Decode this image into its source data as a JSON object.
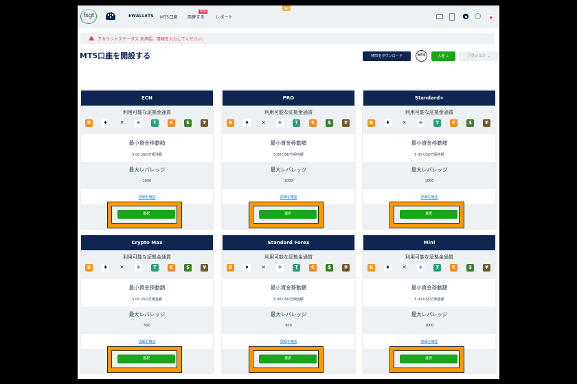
{
  "nav": {
    "logo": "fxgt",
    "items": [
      "EWALLETS",
      "MT5口座",
      "両替する",
      "レポート"
    ],
    "new_badge": "NEW"
  },
  "alert": {
    "text": "アカウントステータス 未承認。情報を入力してください。"
  },
  "header": {
    "title": "MT5口座を開設する",
    "download_label": "MT5をダウンロード",
    "mt5_logo": "MT5",
    "deposit_label": "入金 ⊥",
    "action_label": "アクション ⌄"
  },
  "colors": {
    "navy": "#0e2650",
    "green": "#1aa51a",
    "highlight": "#ff9900",
    "alert": "#e2403f",
    "link": "#1a7ad4"
  },
  "coins": [
    {
      "name": "bitcoin",
      "glyph": "B",
      "color": "#f7931a"
    },
    {
      "name": "ethereum",
      "glyph": "♦",
      "color": "#ffffff",
      "fg": "#222"
    },
    {
      "name": "ripple",
      "glyph": "✕",
      "color": "#eef1f3",
      "fg": "#222"
    },
    {
      "name": "cardano",
      "glyph": "❋",
      "color": "#ffffff",
      "fg": "#3c7de0"
    },
    {
      "name": "tether",
      "glyph": "T",
      "color": "#26a17b"
    },
    {
      "name": "euro",
      "glyph": "€",
      "color": "#f58a1f"
    },
    {
      "name": "dollar",
      "glyph": "$",
      "color": "#3e7d2a"
    },
    {
      "name": "yen",
      "glyph": "¥",
      "color": "#6e5a2a"
    }
  ],
  "cards": [
    {
      "name": "ECN",
      "currencies_label": "利用可能な証拠金通貨",
      "min_transfer_label": "最小資金移動額",
      "min_transfer_value": "5.00 USD方相当額",
      "max_leverage_label": "最大レバレッジ",
      "max_leverage_value": "1000",
      "details_link": "詳細を確認",
      "select_label": "選択"
    },
    {
      "name": "PRO",
      "currencies_label": "利用可能な証拠金通貨",
      "min_transfer_label": "最小資金移動額",
      "min_transfer_value": "5.00 USD方相当額",
      "max_leverage_label": "最大レバレッジ",
      "max_leverage_value": "1000",
      "details_link": "詳細を確認",
      "select_label": "選択"
    },
    {
      "name": "Standard+",
      "currencies_label": "利用可能な証拠金通貨",
      "min_transfer_label": "最小資金移動額",
      "min_transfer_value": "5.00 USD方相当額",
      "max_leverage_label": "最大レバレッジ",
      "max_leverage_value": "1000",
      "details_link": "詳細を確認",
      "select_label": "選択"
    },
    {
      "name": "Crypto Max",
      "currencies_label": "利用可能な証拠金通貨",
      "min_transfer_label": "最小資金移動額",
      "min_transfer_value": "5.00 USD方相当額",
      "max_leverage_label": "最大レバレッジ",
      "max_leverage_value": "500",
      "details_link": "詳細を確認",
      "select_label": "選択"
    },
    {
      "name": "Standard Forex",
      "currencies_label": "利用可能な証拠金通貨",
      "min_transfer_label": "最小資金移動額",
      "min_transfer_value": "5.00 USD方相当額",
      "max_leverage_label": "最大レバレッジ",
      "max_leverage_value": "500",
      "details_link": "詳細を確認",
      "select_label": "選択"
    },
    {
      "name": "Mini",
      "currencies_label": "利用可能な証拠金通貨",
      "min_transfer_label": "最小資金移動額",
      "min_transfer_value": "5.00 USD方相当額",
      "max_leverage_label": "最大レバレッジ",
      "max_leverage_value": "1000",
      "details_link": "詳細を確認",
      "select_label": "選択"
    }
  ]
}
